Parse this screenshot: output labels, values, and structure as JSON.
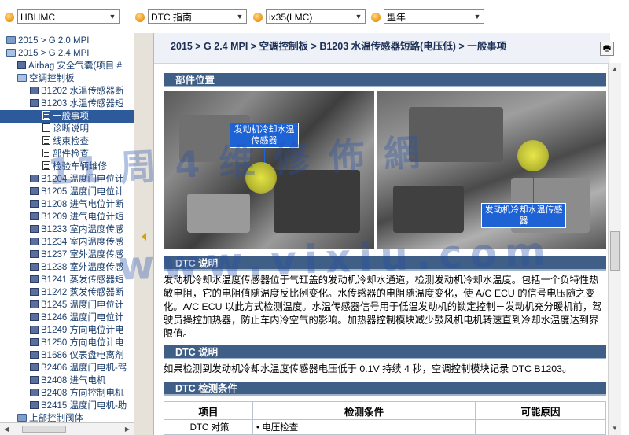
{
  "toolbar": {
    "selects": [
      {
        "value": "HBHMC"
      },
      {
        "value": "DTC 指南"
      },
      {
        "value": "ix35(LMC)"
      },
      {
        "value": "型年"
      }
    ]
  },
  "tree": {
    "items": [
      {
        "label": "2015 > G 2.0 MPI",
        "icon": "folder-icon"
      },
      {
        "label": "2015 > G 2.4 MPI",
        "icon": "folder-open-icon"
      },
      {
        "label": "Airbag 安全气囊(项目 #",
        "icon": "book-icon"
      },
      {
        "label": "空调控制板",
        "icon": "folder-open-icon"
      },
      {
        "label": "B1202 水温传感器断",
        "icon": "book-icon"
      },
      {
        "label": "B1203 水温传感器短",
        "icon": "book-icon"
      },
      {
        "label": "一般事项",
        "icon": "doc-icon"
      },
      {
        "label": "诊断说明",
        "icon": "doc-icon"
      },
      {
        "label": "线束检查",
        "icon": "doc-icon"
      },
      {
        "label": "部件检查",
        "icon": "doc-icon"
      },
      {
        "label": "检验车辆维修",
        "icon": "doc-icon"
      },
      {
        "label": "B1204 温度门电位计",
        "icon": "book-icon"
      },
      {
        "label": "B1205 温度门电位计",
        "icon": "book-icon"
      },
      {
        "label": "B1208 进气电位计断",
        "icon": "book-icon"
      },
      {
        "label": "B1209 进气电位计短",
        "icon": "book-icon"
      },
      {
        "label": "B1233 室内温度传感",
        "icon": "book-icon"
      },
      {
        "label": "B1234 室内温度传感",
        "icon": "book-icon"
      },
      {
        "label": "B1237 室外温度传感",
        "icon": "book-icon"
      },
      {
        "label": "B1238 室外温度传感",
        "icon": "book-icon"
      },
      {
        "label": "B1241 蒸发传感器短",
        "icon": "book-icon"
      },
      {
        "label": "B1242 蒸发传感器断",
        "icon": "book-icon"
      },
      {
        "label": "B1245 温度门电位计",
        "icon": "book-icon"
      },
      {
        "label": "B1246 温度门电位计",
        "icon": "book-icon"
      },
      {
        "label": "B1249 方向电位计电",
        "icon": "book-icon"
      },
      {
        "label": "B1250 方向电位计电",
        "icon": "book-icon"
      },
      {
        "label": "B1686 仪表盘电离剂",
        "icon": "book-icon"
      },
      {
        "label": "B2406 温度门电机-驾",
        "icon": "book-icon"
      },
      {
        "label": "B2408 进气电机",
        "icon": "book-icon"
      },
      {
        "label": "B2408 方向控制电机",
        "icon": "book-icon"
      },
      {
        "label": "B2415 温度门电机-助",
        "icon": "book-icon"
      },
      {
        "label": "上部控制阀体",
        "icon": "folder-icon"
      }
    ]
  },
  "content": {
    "breadcrumb": "2015 > G 2.4 MPI > 空调控制板 > B1203 水温传感器短路(电压低) > 一般事项",
    "sections": {
      "location_title": "部件位置",
      "dtc_desc_title": "DTC 说明",
      "dtc_desc_title2": "DTC 说明",
      "dtc_cond_title": "DTC 检测条件"
    },
    "photo_callouts": {
      "left": "发动机冷却水温传感器",
      "right": "发动机冷却水温传感器"
    },
    "para1": "发动机冷却水温度传感器位于气缸盖的发动机冷却水通道，检测发动机冷却水温度。包括一个负特性热敏电阻，它的电阻值随温度反比例变化。水传感器的电阻随温度变化，使 A/C ECU 的信号电压随之变化。A/C ECU 以此方式检测温度。水温传感器信号用于低温发动机的锁定控制－发动机充分暖机前，驾驶员操控加热器，防止车内冷空气的影响。加热器控制模块减少鼓风机电机转速直到冷却水温度达到界限值。",
    "para2": "如果检测到发动机冷却水温度传感器电压低于 0.1V 持续 4 秒，空调控制模块记录 DTC B1203。",
    "table": {
      "headers": [
        "项目",
        "检测条件",
        "可能原因"
      ],
      "row1": [
        "DTC 对策",
        "• 电压检查",
        ""
      ]
    }
  },
  "watermark": {
    "line1": "11 周 4 维 修 佈 網",
    "line2": "www.vixiu.com"
  },
  "colors": {
    "section_bar": "#3f5f86",
    "tree_selected": "#2d5a9a",
    "callout": "#1e63d6"
  }
}
